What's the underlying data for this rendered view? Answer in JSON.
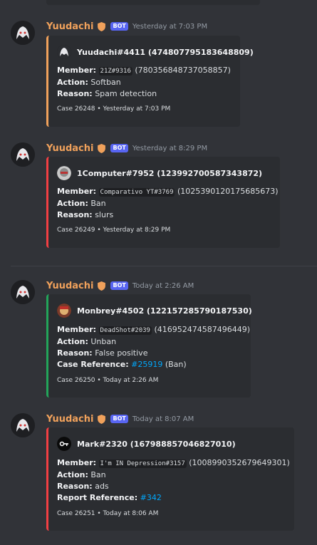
{
  "colors": {
    "orange": "#f0a15b",
    "green": "#23a55a",
    "red": "#f23f43",
    "link": "#00a8fc"
  },
  "icons": {
    "bot_avatar": "yuudachi-avatar",
    "shield": "shield-icon"
  },
  "messages": [
    {
      "author": "Yuudachi",
      "bot_tag": "BOT",
      "timestamp": "Yesterday at 7:03 PM",
      "embed_author": "Yuudachi#4411 (474807795183648809)",
      "member_label": "Member:",
      "member_code": "21Z#9316",
      "member_id": "(780356848737058857)",
      "action_label": "Action:",
      "action": "Softban",
      "reason_label": "Reason:",
      "reason": "Spam detection",
      "footer": "Case 26248 • Yesterday at 7:03 PM"
    },
    {
      "author": "Yuudachi",
      "bot_tag": "BOT",
      "timestamp": "Yesterday at 8:29 PM",
      "embed_author": "1Computer#7952 (123992700587343872)",
      "member_label": "Member:",
      "member_code": "Comparativo YT#3769",
      "member_id": "(1025390120175685673)",
      "action_label": "Action:",
      "action": "Ban",
      "reason_label": "Reason:",
      "reason": "slurs",
      "footer": "Case 26249 • Yesterday at 8:29 PM"
    },
    {
      "author": "Yuudachi",
      "bot_tag": "BOT",
      "timestamp": "Today at 2:26 AM",
      "embed_author": "Monbrey#4502 (122157285790187530)",
      "member_label": "Member:",
      "member_code": "DeadShot#2039",
      "member_id": "(416952474587496449)",
      "action_label": "Action:",
      "action": "Unban",
      "reason_label": "Reason:",
      "reason": "False positive",
      "ref_label": "Case Reference:",
      "ref_link": "#25919",
      "ref_suffix": "(Ban)",
      "footer": "Case 26250 • Today at 2:26 AM"
    },
    {
      "author": "Yuudachi",
      "bot_tag": "BOT",
      "timestamp": "Today at 8:07 AM",
      "embed_author": "Mark#2320 (167988857046827010)",
      "member_label": "Member:",
      "member_code": "I'm IN Depression#3157",
      "member_id": "(1008990352679649301)",
      "action_label": "Action:",
      "action": "Ban",
      "reason_label": "Reason:",
      "reason": "ads",
      "ref_label": "Report Reference:",
      "ref_link": "#342",
      "footer": "Case 26251 • Today at 8:06 AM"
    }
  ]
}
